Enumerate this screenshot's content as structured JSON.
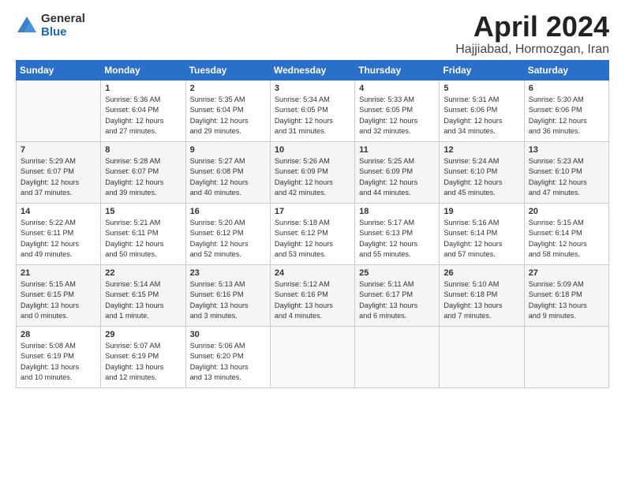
{
  "logo": {
    "general": "General",
    "blue": "Blue"
  },
  "title": "April 2024",
  "location": "Hajjiabad, Hormozgan, Iran",
  "days_header": [
    "Sunday",
    "Monday",
    "Tuesday",
    "Wednesday",
    "Thursday",
    "Friday",
    "Saturday"
  ],
  "weeks": [
    [
      {
        "day": "",
        "info": ""
      },
      {
        "day": "1",
        "info": "Sunrise: 5:36 AM\nSunset: 6:04 PM\nDaylight: 12 hours\nand 27 minutes."
      },
      {
        "day": "2",
        "info": "Sunrise: 5:35 AM\nSunset: 6:04 PM\nDaylight: 12 hours\nand 29 minutes."
      },
      {
        "day": "3",
        "info": "Sunrise: 5:34 AM\nSunset: 6:05 PM\nDaylight: 12 hours\nand 31 minutes."
      },
      {
        "day": "4",
        "info": "Sunrise: 5:33 AM\nSunset: 6:05 PM\nDaylight: 12 hours\nand 32 minutes."
      },
      {
        "day": "5",
        "info": "Sunrise: 5:31 AM\nSunset: 6:06 PM\nDaylight: 12 hours\nand 34 minutes."
      },
      {
        "day": "6",
        "info": "Sunrise: 5:30 AM\nSunset: 6:06 PM\nDaylight: 12 hours\nand 36 minutes."
      }
    ],
    [
      {
        "day": "7",
        "info": "Sunrise: 5:29 AM\nSunset: 6:07 PM\nDaylight: 12 hours\nand 37 minutes."
      },
      {
        "day": "8",
        "info": "Sunrise: 5:28 AM\nSunset: 6:07 PM\nDaylight: 12 hours\nand 39 minutes."
      },
      {
        "day": "9",
        "info": "Sunrise: 5:27 AM\nSunset: 6:08 PM\nDaylight: 12 hours\nand 40 minutes."
      },
      {
        "day": "10",
        "info": "Sunrise: 5:26 AM\nSunset: 6:09 PM\nDaylight: 12 hours\nand 42 minutes."
      },
      {
        "day": "11",
        "info": "Sunrise: 5:25 AM\nSunset: 6:09 PM\nDaylight: 12 hours\nand 44 minutes."
      },
      {
        "day": "12",
        "info": "Sunrise: 5:24 AM\nSunset: 6:10 PM\nDaylight: 12 hours\nand 45 minutes."
      },
      {
        "day": "13",
        "info": "Sunrise: 5:23 AM\nSunset: 6:10 PM\nDaylight: 12 hours\nand 47 minutes."
      }
    ],
    [
      {
        "day": "14",
        "info": "Sunrise: 5:22 AM\nSunset: 6:11 PM\nDaylight: 12 hours\nand 49 minutes."
      },
      {
        "day": "15",
        "info": "Sunrise: 5:21 AM\nSunset: 6:11 PM\nDaylight: 12 hours\nand 50 minutes."
      },
      {
        "day": "16",
        "info": "Sunrise: 5:20 AM\nSunset: 6:12 PM\nDaylight: 12 hours\nand 52 minutes."
      },
      {
        "day": "17",
        "info": "Sunrise: 5:18 AM\nSunset: 6:12 PM\nDaylight: 12 hours\nand 53 minutes."
      },
      {
        "day": "18",
        "info": "Sunrise: 5:17 AM\nSunset: 6:13 PM\nDaylight: 12 hours\nand 55 minutes."
      },
      {
        "day": "19",
        "info": "Sunrise: 5:16 AM\nSunset: 6:14 PM\nDaylight: 12 hours\nand 57 minutes."
      },
      {
        "day": "20",
        "info": "Sunrise: 5:15 AM\nSunset: 6:14 PM\nDaylight: 12 hours\nand 58 minutes."
      }
    ],
    [
      {
        "day": "21",
        "info": "Sunrise: 5:15 AM\nSunset: 6:15 PM\nDaylight: 13 hours\nand 0 minutes."
      },
      {
        "day": "22",
        "info": "Sunrise: 5:14 AM\nSunset: 6:15 PM\nDaylight: 13 hours\nand 1 minute."
      },
      {
        "day": "23",
        "info": "Sunrise: 5:13 AM\nSunset: 6:16 PM\nDaylight: 13 hours\nand 3 minutes."
      },
      {
        "day": "24",
        "info": "Sunrise: 5:12 AM\nSunset: 6:16 PM\nDaylight: 13 hours\nand 4 minutes."
      },
      {
        "day": "25",
        "info": "Sunrise: 5:11 AM\nSunset: 6:17 PM\nDaylight: 13 hours\nand 6 minutes."
      },
      {
        "day": "26",
        "info": "Sunrise: 5:10 AM\nSunset: 6:18 PM\nDaylight: 13 hours\nand 7 minutes."
      },
      {
        "day": "27",
        "info": "Sunrise: 5:09 AM\nSunset: 6:18 PM\nDaylight: 13 hours\nand 9 minutes."
      }
    ],
    [
      {
        "day": "28",
        "info": "Sunrise: 5:08 AM\nSunset: 6:19 PM\nDaylight: 13 hours\nand 10 minutes."
      },
      {
        "day": "29",
        "info": "Sunrise: 5:07 AM\nSunset: 6:19 PM\nDaylight: 13 hours\nand 12 minutes."
      },
      {
        "day": "30",
        "info": "Sunrise: 5:06 AM\nSunset: 6:20 PM\nDaylight: 13 hours\nand 13 minutes."
      },
      {
        "day": "",
        "info": ""
      },
      {
        "day": "",
        "info": ""
      },
      {
        "day": "",
        "info": ""
      },
      {
        "day": "",
        "info": ""
      }
    ]
  ]
}
